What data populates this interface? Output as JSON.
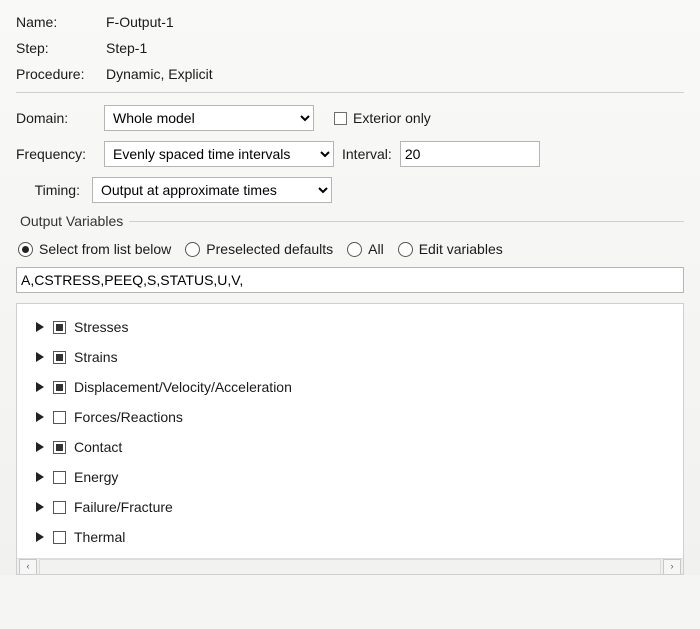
{
  "labels": {
    "name": "Name:",
    "step": "Step:",
    "procedure": "Procedure:",
    "domain": "Domain:",
    "exterior_only": "Exterior only",
    "frequency": "Frequency:",
    "interval": "Interval:",
    "timing": "Timing:",
    "output_vars_legend": "Output Variables"
  },
  "values": {
    "name": "F-Output-1",
    "step": "Step-1",
    "procedure": "Dynamic, Explicit",
    "domain_selected": "Whole model",
    "exterior_only_checked": false,
    "frequency_selected": "Evenly spaced time intervals",
    "interval": "20",
    "timing_selected": "Output at approximate times",
    "vars_string": "A,CSTRESS,PEEQ,S,STATUS,U,V,"
  },
  "outvar_mode": {
    "options": [
      {
        "key": "select_list",
        "label": "Select from list below",
        "selected": true
      },
      {
        "key": "preselected",
        "label": "Preselected defaults",
        "selected": false
      },
      {
        "key": "all",
        "label": "All",
        "selected": false
      },
      {
        "key": "edit",
        "label": "Edit variables",
        "selected": false
      }
    ]
  },
  "tree": [
    {
      "label": "Stresses",
      "state": "partial"
    },
    {
      "label": "Strains",
      "state": "partial"
    },
    {
      "label": "Displacement/Velocity/Acceleration",
      "state": "partial"
    },
    {
      "label": "Forces/Reactions",
      "state": "unchecked"
    },
    {
      "label": "Contact",
      "state": "partial"
    },
    {
      "label": "Energy",
      "state": "unchecked"
    },
    {
      "label": "Failure/Fracture",
      "state": "unchecked"
    },
    {
      "label": "Thermal",
      "state": "unchecked"
    }
  ]
}
